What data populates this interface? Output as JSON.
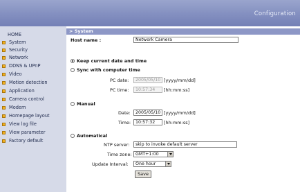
{
  "header": {
    "brand": "Configuration"
  },
  "sidebar": {
    "home": "HOME",
    "items": [
      "System",
      "Security",
      "Network",
      "DDNS & UPnP",
      "Video",
      "Motion detection",
      "Application",
      "Camera control",
      "Modem",
      "Homepage layout",
      "View log file",
      "View parameter",
      "Factory default"
    ]
  },
  "section": {
    "title": "> System"
  },
  "form": {
    "host_name_label": "Host name :",
    "host_name_value": "Network Camera",
    "keep_label": "Keep current date and time",
    "sync_label": "Sync with computer time",
    "pc_date_label": "PC date:",
    "pc_date_value": "2005/05/10",
    "pc_date_format": "[yyyy/mm/dd]",
    "pc_time_label": "PC time:",
    "pc_time_value": "10:57:34",
    "pc_time_format": "[hh:mm:ss]",
    "manual_label": "Manual",
    "date_label": "Date:",
    "date_value": "2005/05/10",
    "date_format": "[yyyy/mm/dd]",
    "time_label": "Time:",
    "time_value": "10:57:32",
    "time_format": "[hh:mm:ss]",
    "auto_label": "Automatical",
    "ntp_label": "NTP server:",
    "ntp_value": "skip to invoke default server",
    "tz_label": "Time zone:",
    "tz_value": "GMT+1:00",
    "interval_label": "Update Interval:",
    "interval_value": "One hour",
    "save_label": "Save"
  }
}
